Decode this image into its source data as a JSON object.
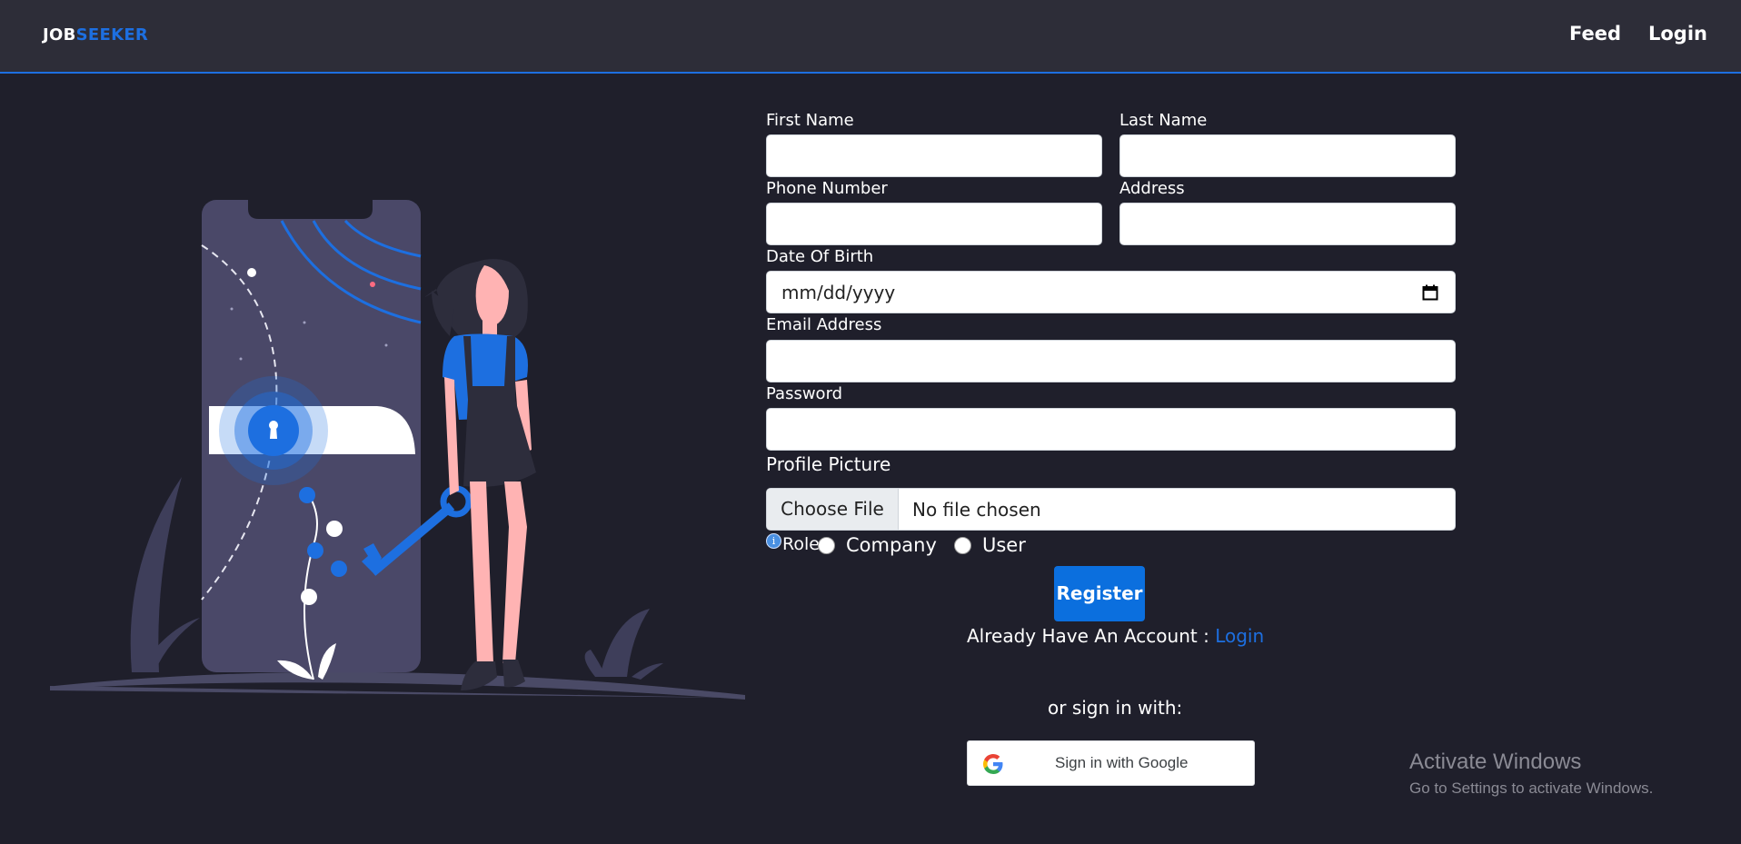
{
  "navbar": {
    "brand_part1": "JOB",
    "brand_part2": "SEEKER",
    "feed_label": "Feed",
    "login_label": "Login"
  },
  "form": {
    "first_name_label": "First Name",
    "last_name_label": "Last Name",
    "phone_label": "Phone Number",
    "address_label": "Address",
    "dob_label": "Date Of Birth",
    "dob_placeholder": "mm/dd/yyyy",
    "email_label": "Email Address",
    "password_label": "Password",
    "profile_label": "Profile Picture",
    "file_button": "Choose File",
    "file_status": "No file chosen",
    "role_label": "Role",
    "role_options": [
      "Company",
      "User"
    ],
    "register_label": "Register",
    "already_text": "Already Have An Account : ",
    "already_link": "Login",
    "or_text": "or sign in with:",
    "google_label": "Sign in with Google"
  },
  "watermark": {
    "title": "Activate Windows",
    "subtitle": "Go to Settings to activate Windows."
  },
  "colors": {
    "background": "#1f1f2b",
    "navbar": "#2d2d38",
    "accent": "#1d6fe0",
    "button": "#0b6fde"
  },
  "icons": [
    "calendar-icon",
    "info-icon",
    "google-icon",
    "keyhole-icon"
  ]
}
